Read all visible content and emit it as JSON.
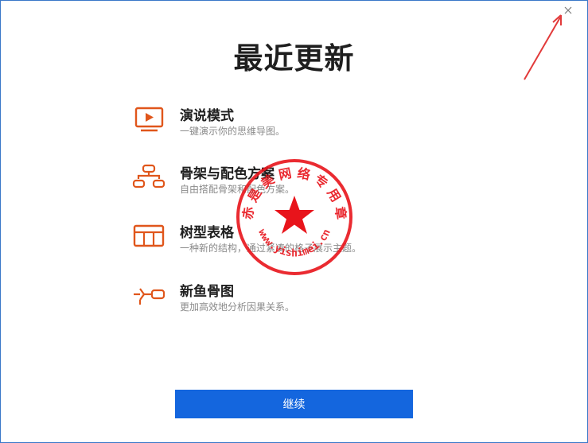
{
  "dialog": {
    "title": "最近更新",
    "close_icon": "close-icon",
    "continue_label": "继续"
  },
  "features": [
    {
      "icon": "presentation-icon",
      "title": "演说模式",
      "desc": "一键演示你的思维导图。"
    },
    {
      "icon": "structure-icon",
      "title": "骨架与配色方案",
      "desc": "自由搭配骨架和配色方案。"
    },
    {
      "icon": "table-icon",
      "title": "树型表格",
      "desc": "一种新的结构，通过紧凑的格子展示主题。"
    },
    {
      "icon": "fishbone-icon",
      "title": "新鱼骨图",
      "desc": "更加高效地分析因果关系。"
    }
  ],
  "stamp": {
    "text": "赤 是 美 网 络 专 用 章",
    "url": "www.yishimei.cn"
  },
  "colors": {
    "accent_orange": "#e0561b",
    "button_blue": "#1466de",
    "stamp_red": "#e8141b",
    "annotation_arrow": "#e23a3a"
  }
}
